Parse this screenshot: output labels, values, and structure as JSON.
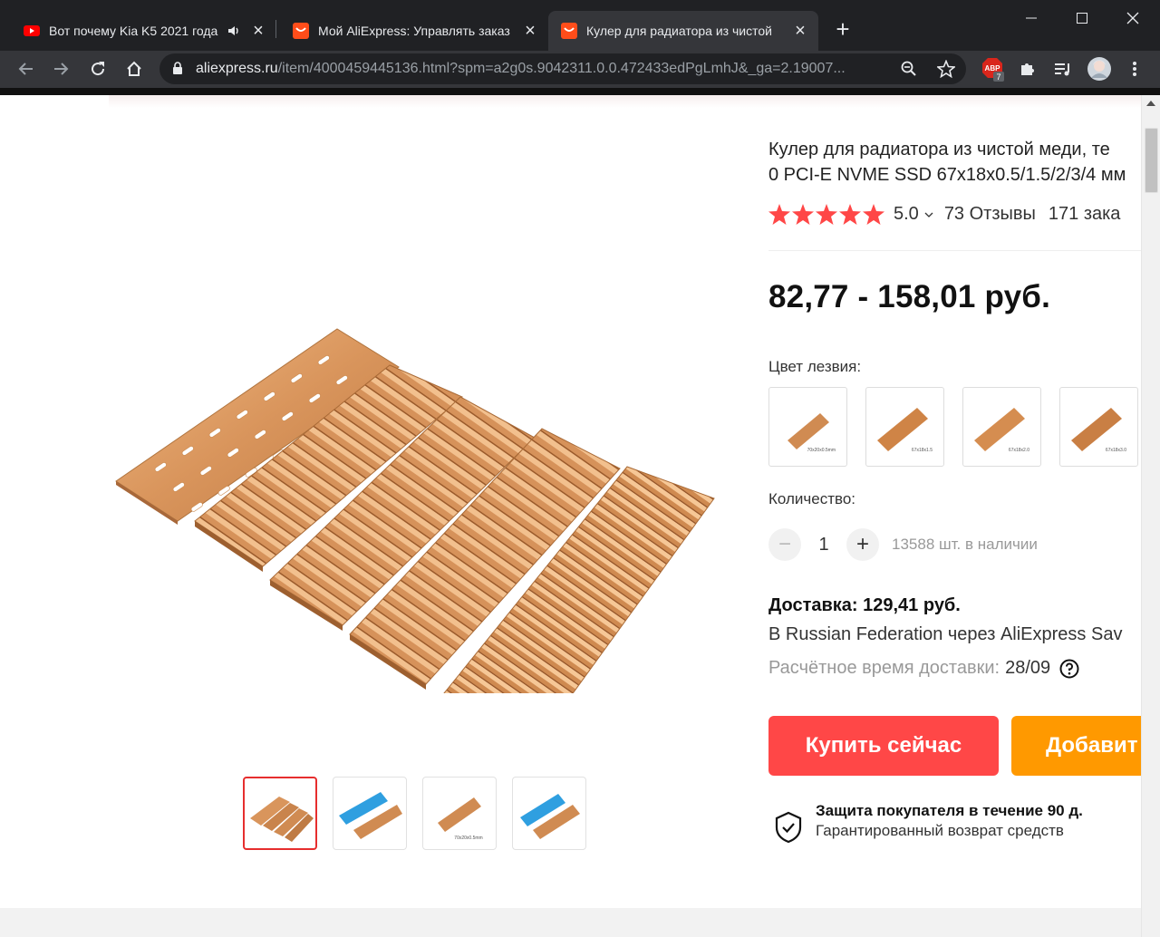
{
  "browser": {
    "tabs": [
      {
        "title": "Вот почему Kia K5 2021 года",
        "icon": "youtube-icon",
        "audio": true,
        "active": false
      },
      {
        "title": "Мой AliExpress: Управлять заказ",
        "icon": "aliexpress-icon",
        "audio": false,
        "active": false
      },
      {
        "title": "Кулер для радиатора из чистой",
        "icon": "aliexpress-icon",
        "audio": false,
        "active": true
      }
    ],
    "url_host": "aliexpress.ru",
    "url_path": "/item/4000459445136.html?spm=a2g0s.9042311.0.0.472433edPgLmhJ&_ga=2.19007...",
    "extension_badge": "7",
    "extension_label": "ABP"
  },
  "product": {
    "title_line1": "Кулер для радиатора из чистой меди, те",
    "title_line2": "0 PCI-E NVME SSD 67x18x0.5/1.5/2/3/4 мм",
    "rating": "5.0",
    "reviews": "73 Отзывы",
    "orders": "171 зака",
    "price": "82,77 - 158,01 руб.",
    "color_label": "Цвет лезвия:",
    "swatch_captions": [
      "70x20x0.5mm",
      "67x18x1.5",
      "67x18x2.0",
      "67x18x3.0"
    ],
    "quantity_label": "Количество:",
    "quantity": "1",
    "stock": "13588 шт. в наличии",
    "shipping_cost": "Доставка: 129,41 руб.",
    "shipping_via": "В Russian Federation через AliExpress Sav",
    "delivery_label": "Расчётное время доставки:",
    "delivery_date": "28/09",
    "buy_now": "Купить сейчас",
    "add_to_cart": "Добавит",
    "protection_title": "Защита покупателя в течение 90 д.",
    "protection_sub": "Гарантированный возврат средств",
    "thumbnail_caption": "70x20x0.5mm"
  },
  "colors": {
    "accent_red": "#ff4747",
    "accent_orange": "#ff9900",
    "star": "#ff4747",
    "copper": "#d9955c"
  }
}
